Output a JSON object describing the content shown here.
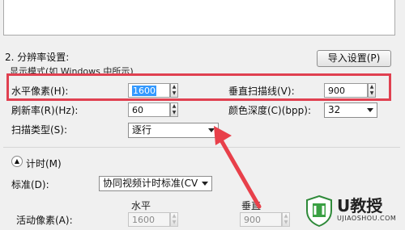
{
  "section2": {
    "title": "2. 分辨率设置:",
    "import_button": "导入设置(P)",
    "mode_label": "显示模式(如 Windows 中所示)"
  },
  "horizontal_pixels": {
    "label": "水平像素(H):",
    "value": "1600"
  },
  "vertical_scanlines": {
    "label": "垂直扫描线(V):",
    "value": "900"
  },
  "refresh_rate": {
    "label": "刷新率(R)(Hz):",
    "value": "60"
  },
  "color_depth": {
    "label": "颜色深度(C)(bpp):",
    "value": "32"
  },
  "scan_type": {
    "label": "扫描类型(S):",
    "value": "逐行"
  },
  "timing": {
    "header": "计时(M)",
    "standard_label": "标准(D):",
    "standard_value": "协同视频计时标准(CV",
    "col_horizontal": "水平",
    "col_vertical": "垂直",
    "active_pixels_label": "活动像素(A):",
    "active_h": "1600",
    "active_v": "900"
  },
  "watermark": {
    "logo_text": "U教授",
    "site": "UJIAOSHOU.COM"
  },
  "colors": {
    "highlight": "#e04050",
    "arrow": "#e8404a",
    "accent": "#3399ff"
  }
}
